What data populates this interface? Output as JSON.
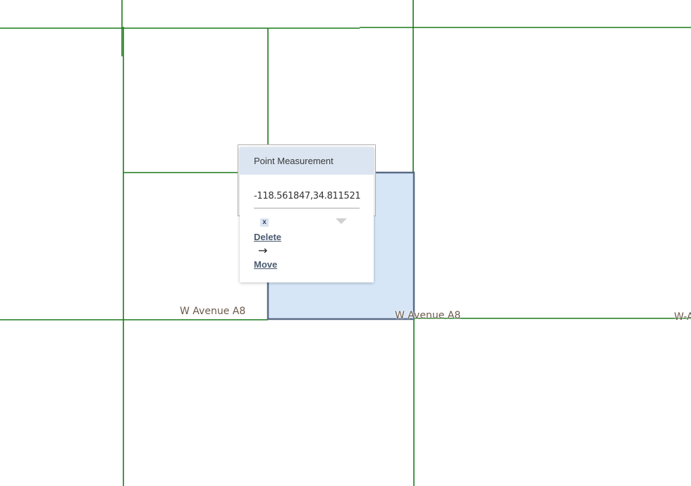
{
  "map": {
    "colors": {
      "parcel_line": "#1a7a1a",
      "selected_fill": "#d6e6f7",
      "selected_stroke": "#5a6a88",
      "road_label": "#6b5a4a"
    },
    "road_labels": [
      "W Avenue A8",
      "W Avenue A8",
      "W-A"
    ]
  },
  "popup": {
    "title": "Point Measurement",
    "coordinates": "-118.561847,34.811521",
    "close_label": "x",
    "delete_label": "Delete",
    "arrow_glyph": "→",
    "move_label": "Move",
    "icons": [
      "close-icon",
      "dropdown-arrow-icon",
      "right-arrow-icon"
    ]
  }
}
